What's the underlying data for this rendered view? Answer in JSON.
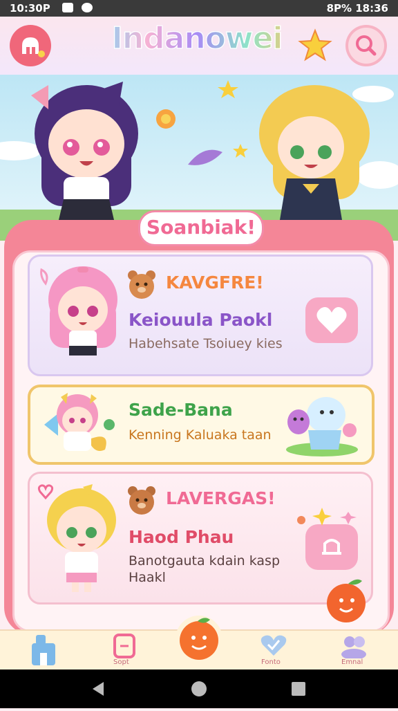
{
  "status_bar": {
    "time": "10:30P",
    "right_text": "8P% 18:36"
  },
  "header": {
    "app_title": "Indanowei",
    "home_icon": "shop-icon",
    "star_icon": "star-icon",
    "search_icon": "search-icon"
  },
  "banner": {
    "label": "Soanbiak!"
  },
  "cards": [
    {
      "tag": "KAVGFRE!",
      "name": "Keiouula Paokl",
      "desc": "Habehsate Tsoiuey kies",
      "action_icon": "heart-icon",
      "mascot_icon": "bear-icon"
    },
    {
      "name": "Sade-Bana",
      "desc": "Kenning Kaluaka taan"
    },
    {
      "tag": "LAVERGAS!",
      "name": "Haod Phau",
      "desc": "Banotgauta kdain kasp",
      "desc2": "Haakl",
      "action_icon": "gift-icon",
      "mascot_icon": "bear-icon"
    }
  ],
  "bottom_nav": {
    "items": [
      {
        "label": "",
        "icon": "home-icon"
      },
      {
        "label": "Sopt",
        "icon": "note-icon"
      },
      {
        "label": "",
        "icon": "orange-icon"
      },
      {
        "label": "Fonto",
        "icon": "heart-check-icon"
      },
      {
        "label": "Emnal",
        "icon": "friends-icon"
      }
    ]
  },
  "colors": {
    "accent": "#f06a94",
    "panel": "#f48697",
    "card_yellow_border": "#f0c56b",
    "title_purple": "#8a55c8"
  }
}
